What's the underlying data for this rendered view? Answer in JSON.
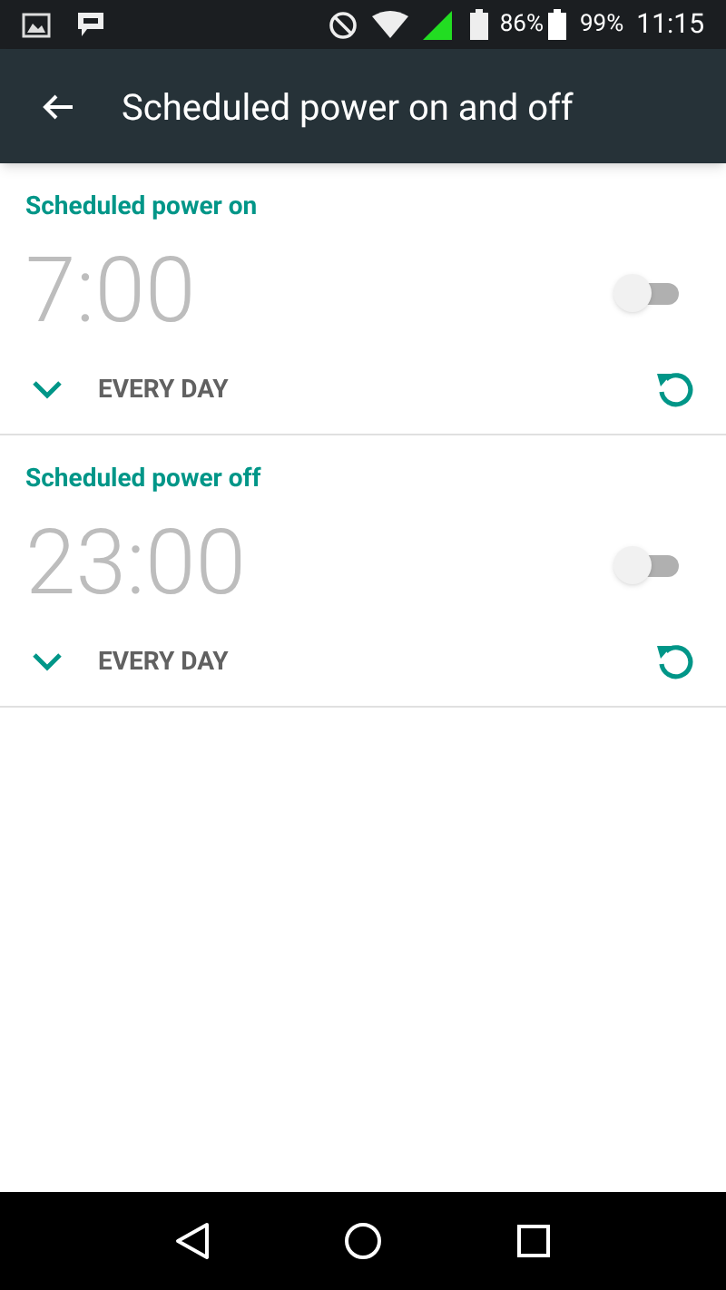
{
  "status_bar": {
    "battery_1": "86%",
    "battery_2": "99%",
    "time": "11:15"
  },
  "app_bar": {
    "title": "Scheduled power on and off"
  },
  "schedules": [
    {
      "title": "Scheduled power on",
      "time": "7:00",
      "on": false,
      "repeat": "EVERY DAY"
    },
    {
      "title": "Scheduled power off",
      "time": "23:00",
      "on": false,
      "repeat": "EVERY DAY"
    }
  ]
}
